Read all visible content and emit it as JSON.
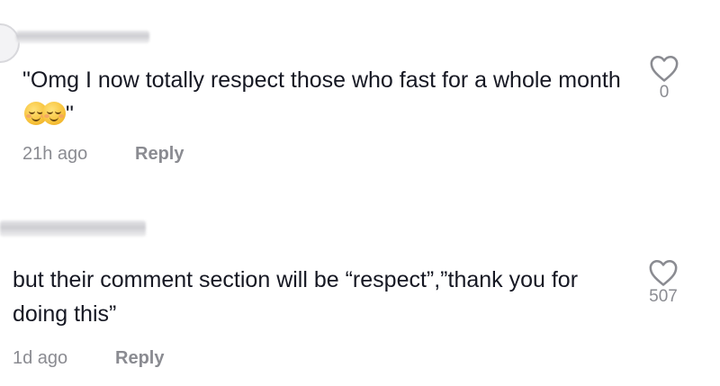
{
  "comments": [
    {
      "text": "\"Omg I now totally respect those who fast for a whole month ",
      "text_tail": "\"",
      "time": "21h ago",
      "reply_label": "Reply",
      "like_count": "0"
    },
    {
      "text": "but their comment section will be “respect”,”thank you for doing this”",
      "time": "1d ago",
      "reply_label": "Reply",
      "like_count": "507"
    }
  ],
  "icons": {
    "like": "heart-outline-icon",
    "emoji": "relieved-face-emoji"
  }
}
